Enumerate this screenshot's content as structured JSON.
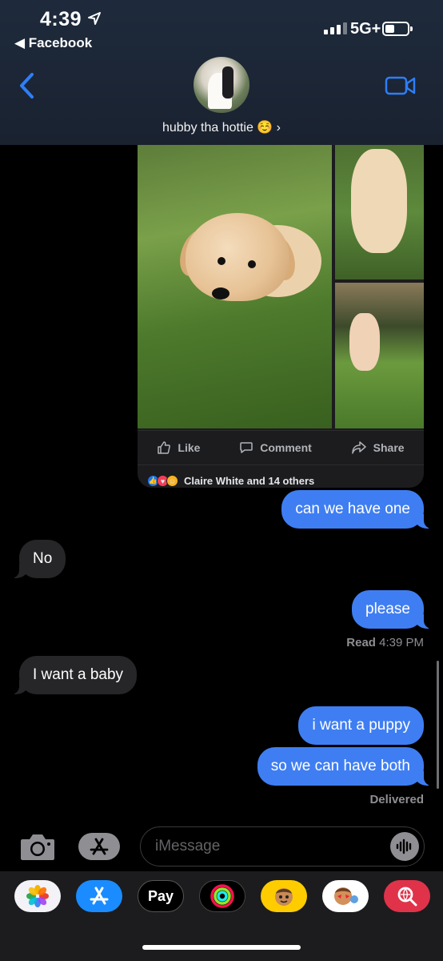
{
  "status_bar": {
    "time": "4:39",
    "back_app": "◀ Facebook",
    "network": "5G+"
  },
  "header": {
    "contact_name": "hubby tha hottie ☺️ ›"
  },
  "post": {
    "actions": [
      {
        "label": "Like",
        "icon": "thumbs-up-icon"
      },
      {
        "label": "Comment",
        "icon": "comment-icon"
      },
      {
        "label": "Share",
        "icon": "share-icon"
      }
    ],
    "reactions_text": "Claire White and 14 others"
  },
  "messages": [
    {
      "direction": "out",
      "text": "can we have one"
    },
    {
      "direction": "in",
      "text": "No"
    },
    {
      "direction": "out",
      "text": "please"
    },
    {
      "direction": "in",
      "text": "I want a baby"
    },
    {
      "direction": "out",
      "text": "i want a puppy"
    },
    {
      "direction": "out",
      "text": "so we can have both"
    }
  ],
  "receipts": {
    "read_label": "Read",
    "read_time": "4:39 PM",
    "delivered": "Delivered"
  },
  "composer": {
    "placeholder": "iMessage"
  },
  "app_drawer": {
    "apps": [
      {
        "name": "photos-app-icon"
      },
      {
        "name": "app-store-icon"
      },
      {
        "name": "apple-pay-icon",
        "label": "Pay"
      },
      {
        "name": "activity-app-icon"
      },
      {
        "name": "memoji-icon"
      },
      {
        "name": "memoji-stickers-icon"
      },
      {
        "name": "web-images-search-icon"
      }
    ]
  },
  "colors": {
    "outgoing_bubble": "#3f7ef2",
    "incoming_bubble": "#262628",
    "accent": "#2f7ef6",
    "header_bg": "#1e2a3c"
  }
}
